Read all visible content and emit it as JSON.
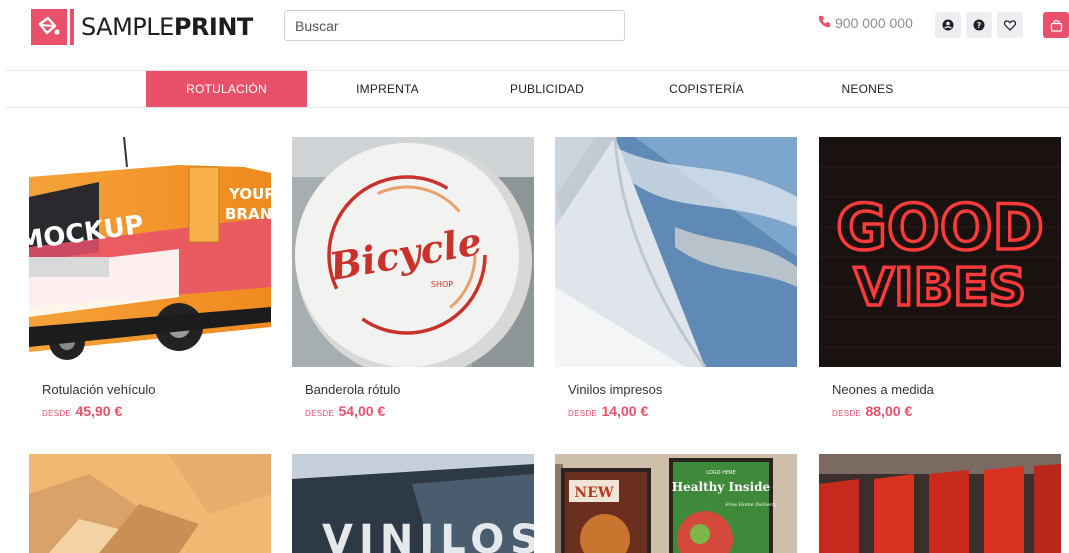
{
  "header": {
    "brand_regular": "SAMPLE",
    "brand_bold": "PRINT",
    "search_placeholder": "Buscar",
    "phone": "900 000 000",
    "icons": [
      "user-icon",
      "help-icon",
      "heart-icon",
      "cart-icon"
    ]
  },
  "nav": {
    "items": [
      {
        "label": "ROTULACIÓN",
        "active": true
      },
      {
        "label": "IMPRENTA",
        "active": false
      },
      {
        "label": "PUBLICIDAD",
        "active": false
      },
      {
        "label": "COPISTERÍA",
        "active": false
      },
      {
        "label": "NEONES",
        "active": false
      }
    ]
  },
  "products": [
    {
      "name": "Rotulación vehículo",
      "from": "DESDE",
      "price": "45,90 €"
    },
    {
      "name": "Banderola rótulo",
      "from": "DESDE",
      "price": "54,00 €"
    },
    {
      "name": "Vinilos impresos",
      "from": "DESDE",
      "price": "14,00 €"
    },
    {
      "name": "Neones a medida",
      "from": "DESDE",
      "price": "88,00 €"
    }
  ],
  "images": {
    "van_text_1": "YOUR",
    "van_text_2": "BRAND",
    "van_text_3": "MOCKUP",
    "sign_text": "Bicycle",
    "sign_sub": "SHOP",
    "neon_1": "GOOD",
    "neon_2": "VIBES",
    "vinyl_word": "VINILOS",
    "poster_1": "NEW",
    "poster_2_small": "LOGO HERE",
    "poster_2": "Healthy Inside",
    "poster_2_script": "Free Home Delivery"
  },
  "colors": {
    "accent": "#e9516b"
  }
}
